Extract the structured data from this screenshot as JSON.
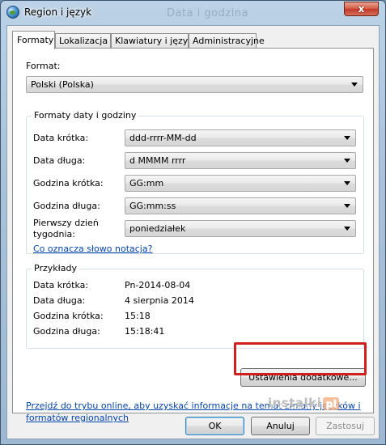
{
  "window": {
    "title": "Region i język",
    "background_title": "Data i godzina",
    "close_glyph": "x",
    "icon": "globe-icon"
  },
  "tabs": [
    {
      "label": "Formaty",
      "active": true
    },
    {
      "label": "Lokalizacja",
      "active": false
    },
    {
      "label": "Klawiatury i języki",
      "active": false
    },
    {
      "label": "Administracyjne",
      "active": false
    }
  ],
  "format": {
    "label": "Format:",
    "value": "Polski (Polska)"
  },
  "datetime_group": {
    "title": "Formaty daty i godziny",
    "rows": [
      {
        "label": "Data krótka:",
        "value": "ddd-rrrr-MM-dd"
      },
      {
        "label": "Data długa:",
        "value": "d MMMM rrrr"
      },
      {
        "label": "Godzina krótka:",
        "value": "GG:mm"
      },
      {
        "label": "Godzina długa:",
        "value": "GG:mm:ss"
      },
      {
        "label": "Pierwszy dzień tygodnia:",
        "value": "poniedziałek"
      }
    ],
    "notation_link": "Co oznacza słowo notacja?"
  },
  "examples_group": {
    "title": "Przykłady",
    "rows": [
      {
        "label": "Data krótka:",
        "value": "Pn-2014-08-04"
      },
      {
        "label": "Data długa:",
        "value": "4 sierpnia 2014"
      },
      {
        "label": "Godzina krótka:",
        "value": "15:18"
      },
      {
        "label": "Godzina długa:",
        "value": "15:18:41"
      }
    ]
  },
  "additional_settings_button": "Ustawienia dodatkowe...",
  "online_link": "Przejdź do trybu online, aby uzyskać informacje na temat zmiany języków i formatów regionalnych",
  "buttons": {
    "ok": "OK",
    "cancel": "Anuluj",
    "apply": "Zastosuj"
  },
  "watermark": {
    "text": "instalki",
    "suffix": "pl"
  },
  "colors": {
    "link": "#0645ad",
    "highlight": "#d01f1f",
    "close_button": "#c0392b"
  }
}
